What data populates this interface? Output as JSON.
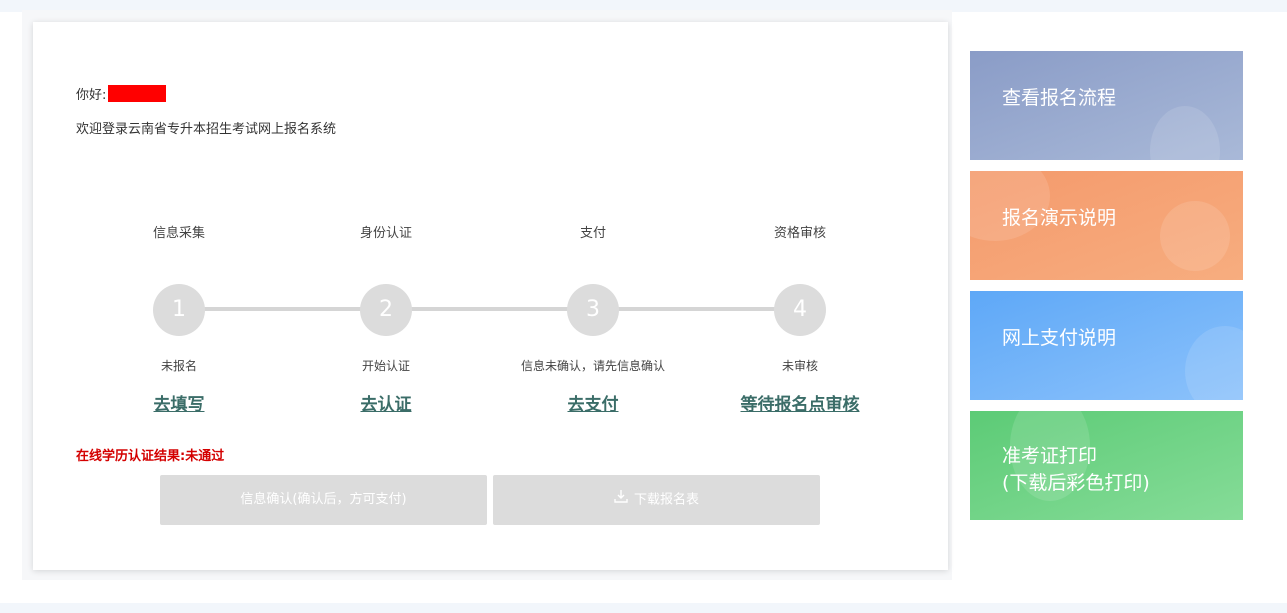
{
  "greeting": {
    "prefix": "你好:",
    "welcome": "欢迎登录云南省专升本招生考试网上报名系统"
  },
  "steps": [
    {
      "title": "信息采集",
      "number": "1",
      "status": "未报名",
      "action": "去填写"
    },
    {
      "title": "身份认证",
      "number": "2",
      "status": "开始认证",
      "action": "去认证"
    },
    {
      "title": "支付",
      "number": "3",
      "status": "信息未确认，请先信息确认",
      "action": "去支付"
    },
    {
      "title": "资格审核",
      "number": "4",
      "status": "未审核",
      "action": "等待报名点审核"
    }
  ],
  "result_text": "在线学历认证结果:未通过",
  "buttons": {
    "confirm": "信息确认(确认后，方可支付)",
    "download": "下载报名表",
    "download_icon": "download-icon"
  },
  "side_links": [
    {
      "label": "查看报名流程",
      "color": "#8a9cc7"
    },
    {
      "label": "报名演示说明",
      "color": "#f49a6c"
    },
    {
      "label": "网上支付说明",
      "color": "#5ea8f7"
    },
    {
      "label": "准考证打印",
      "label2": "(下载后彩色打印)",
      "color": "#5ccb76"
    }
  ],
  "colors": {
    "accent_text": "#3b6d68",
    "error": "#d40000",
    "step_circle": "#dcdcdc"
  }
}
